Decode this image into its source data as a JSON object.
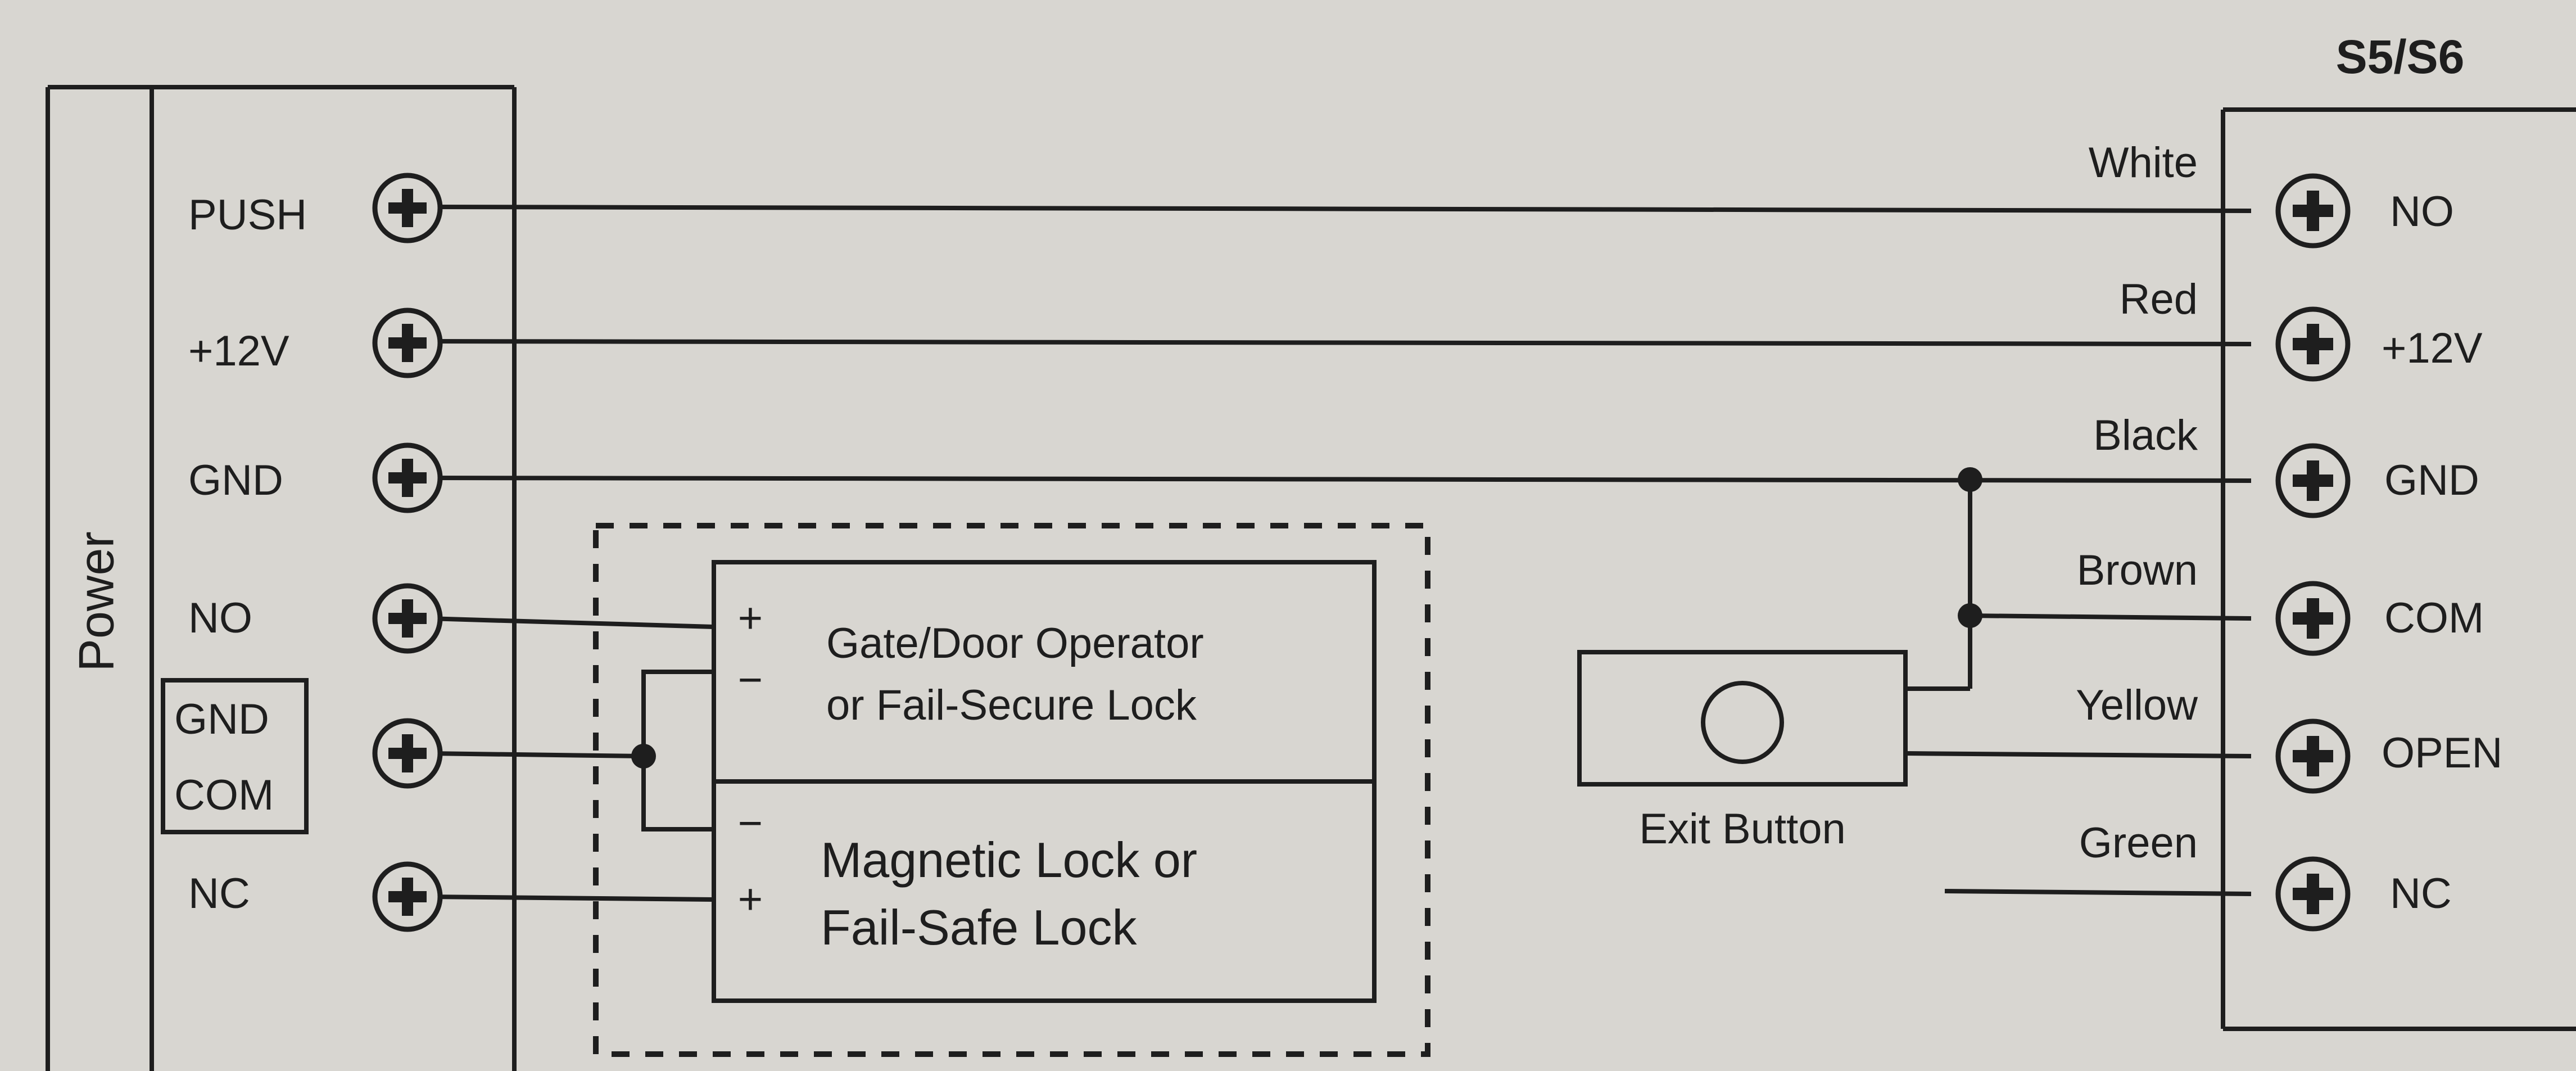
{
  "power_block": {
    "title": "Power",
    "terminals": [
      "PUSH",
      "+12V",
      "GND",
      "NO",
      "",
      "NC"
    ],
    "shared_label_top": "GND",
    "shared_label_bottom": "COM"
  },
  "controller": {
    "title": "S5/S6",
    "terminals": [
      "NO",
      "+12V",
      "GND",
      "COM",
      "OPEN",
      "NC"
    ],
    "wire_colors": [
      "White",
      "Red",
      "Black",
      "Brown",
      "Yellow",
      "Green"
    ]
  },
  "lock_top": {
    "line1": "Gate/Door Operator",
    "line2": "or Fail-Secure Lock",
    "plus": "+",
    "minus": "−"
  },
  "lock_bottom": {
    "line1": "Magnetic Lock or",
    "line2": "Fail-Safe Lock",
    "plus": "+",
    "minus": "−"
  },
  "exit_button": {
    "label": "Exit Button"
  }
}
